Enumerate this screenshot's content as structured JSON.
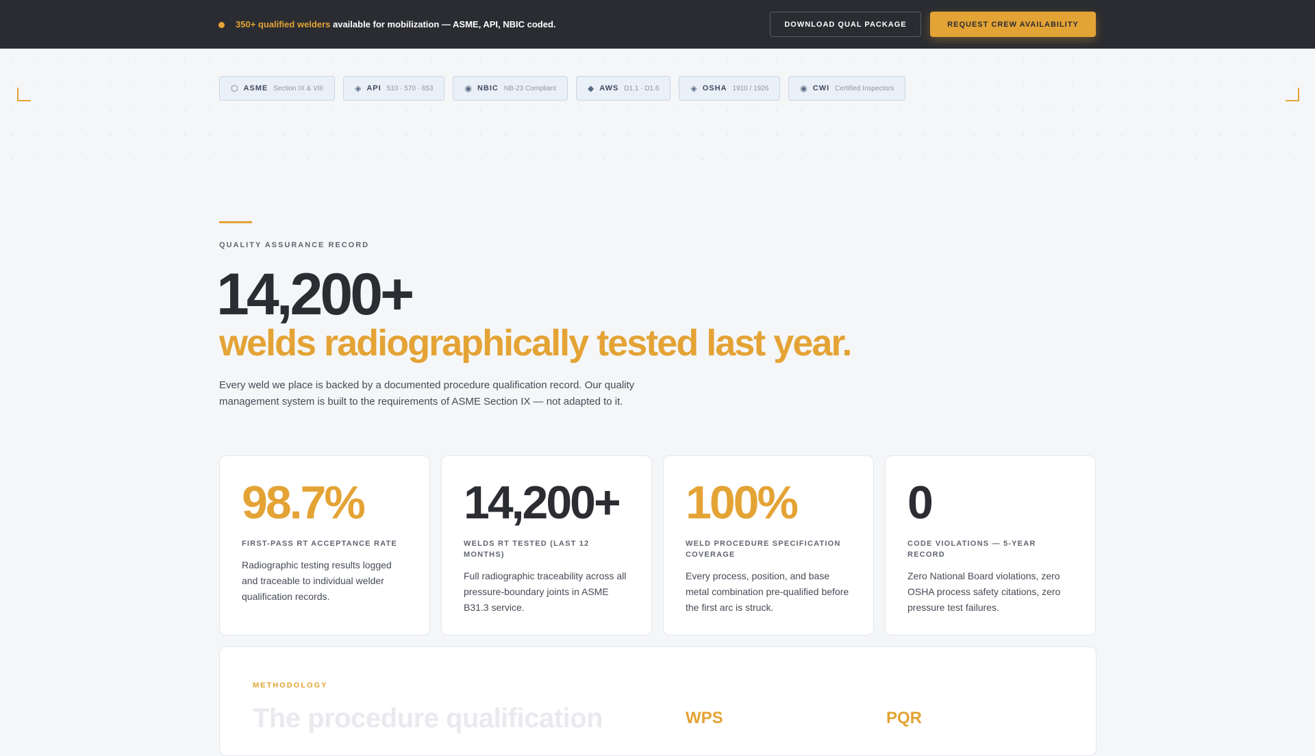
{
  "topbar": {
    "highlight": "350+ qualified welders",
    "message": " available for mobilization — ASME, API, NBIC coded.",
    "download_label": "DOWNLOAD QUAL PACKAGE",
    "request_label": "REQUEST CREW AVAILABILITY"
  },
  "badges": [
    {
      "icon": "⬡",
      "icon_name": "hexagon-icon",
      "name": "ASME",
      "desc": "Section IX & VIII"
    },
    {
      "icon": "◈",
      "icon_name": "diamond-outline-icon",
      "name": "API",
      "desc": "510 · 570 · 653"
    },
    {
      "icon": "◉",
      "icon_name": "target-circle-icon",
      "name": "NBIC",
      "desc": "NB-23 Compliant"
    },
    {
      "icon": "◆",
      "icon_name": "diamond-icon",
      "name": "AWS",
      "desc": "D1.1 · D1.6"
    },
    {
      "icon": "◈",
      "icon_name": "diamond-outline-icon",
      "name": "OSHA",
      "desc": "1910 / 1926"
    },
    {
      "icon": "◉",
      "icon_name": "target-circle-icon",
      "name": "CWI",
      "desc": "Certified Inspectors"
    }
  ],
  "hero": {
    "eyebrow": "QUALITY ASSURANCE RECORD",
    "big_number": "14,200+",
    "headline": "welds radiographically tested last year.",
    "intro": "Every weld we place is backed by a documented procedure qualification record. Our quality management system is built to the requirements of ASME Section IX — not adapted to it."
  },
  "stats": [
    {
      "value": "98.7%",
      "label": "FIRST-PASS RT ACCEPTANCE RATE",
      "desc": "Radiographic testing results logged and traceable to individual welder qualification records."
    },
    {
      "value": "14,200+",
      "label": "WELDS RT TESTED (LAST 12 MONTHS)",
      "desc": "Full radiographic traceability across all pressure-boundary joints in ASME B31.3 service."
    },
    {
      "value": "100%",
      "label": "WELD PROCEDURE SPECIFICATION COVERAGE",
      "desc": "Every process, position, and base metal combination pre-qualified before the first arc is struck."
    },
    {
      "value": "0",
      "label": "CODE VIOLATIONS — 5-YEAR RECORD",
      "desc": "Zero National Board violations, zero OSHA process safety citations, zero pressure test failures."
    }
  ],
  "methodology": {
    "eyebrow": "METHODOLOGY",
    "title": "The procedure qualification",
    "col1": "WPS",
    "col2": "PQR"
  },
  "colors": {
    "accent": "#e4a335",
    "dark": "#2a2c31",
    "background": "#f5f6f8"
  }
}
